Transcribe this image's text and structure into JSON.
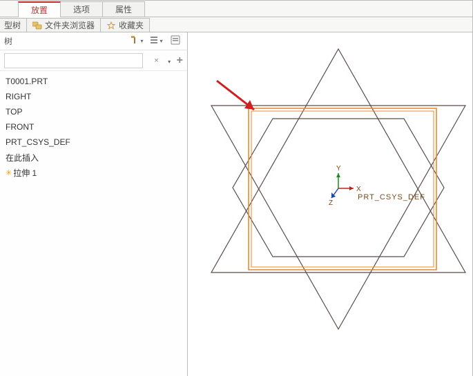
{
  "top_tabs": {
    "placement": "放置",
    "options": "选项",
    "attributes": "属性"
  },
  "sec_tabs": {
    "model_tree": "型树",
    "folder_browser": "文件夹浏览器",
    "favorites": "收藏夹"
  },
  "tree_header": {
    "title": "树"
  },
  "filter": {
    "value": "",
    "placeholder": ""
  },
  "tree_items": [
    "T0001.PRT",
    "RIGHT",
    "TOP",
    "FRONT",
    "PRT_CSYS_DEF",
    "在此插入",
    "拉伸 1"
  ],
  "csys": {
    "label": "PRT_CSYS_DEF",
    "x": "X",
    "y": "Y",
    "z": "Z"
  },
  "colors": {
    "highlight": "#e98a2e",
    "geom": "#5a4a4a",
    "arrow": "#d11f1f",
    "csys_x": "#c02020",
    "csys_y": "#1a8a1a",
    "csys_z": "#1a4aa8"
  }
}
